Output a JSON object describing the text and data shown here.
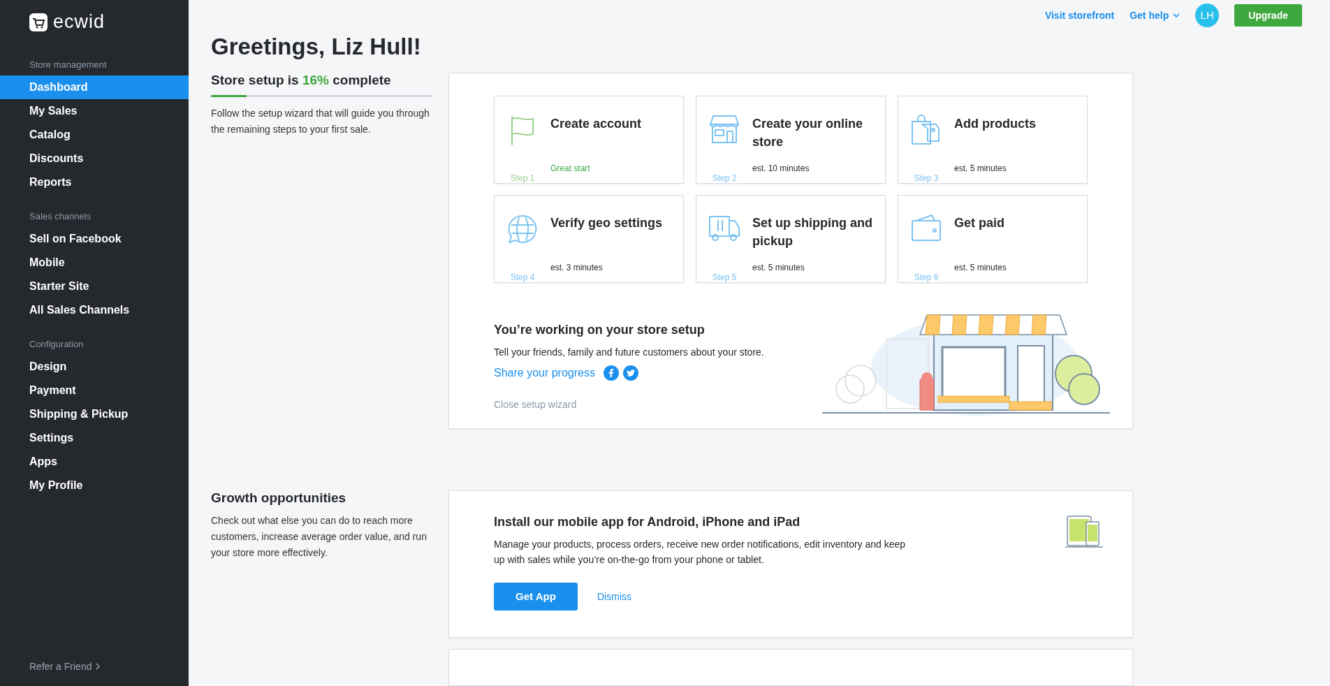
{
  "logo": {
    "text": "ecwid"
  },
  "sidebar": {
    "sections": [
      {
        "heading": "Store management",
        "items": [
          {
            "label": "Dashboard",
            "selected": true
          },
          {
            "label": "My Sales",
            "selected": false
          },
          {
            "label": "Catalog",
            "selected": false
          },
          {
            "label": "Discounts",
            "selected": false
          },
          {
            "label": "Reports",
            "selected": false
          }
        ]
      },
      {
        "heading": "Sales channels",
        "items": [
          {
            "label": "Sell on Facebook",
            "selected": false
          },
          {
            "label": "Mobile",
            "selected": false
          },
          {
            "label": "Starter Site",
            "selected": false
          },
          {
            "label": "All Sales Channels",
            "selected": false
          }
        ]
      },
      {
        "heading": "Configuration",
        "items": [
          {
            "label": "Design",
            "selected": false
          },
          {
            "label": "Payment",
            "selected": false
          },
          {
            "label": "Shipping & Pickup",
            "selected": false
          },
          {
            "label": "Settings",
            "selected": false
          },
          {
            "label": "Apps",
            "selected": false
          },
          {
            "label": "My Profile",
            "selected": false
          }
        ]
      }
    ],
    "footer_link": "Refer a Friend"
  },
  "topbar": {
    "visit_link": "Visit storefront",
    "help_link": "Get help",
    "avatar": "LH",
    "upgrade_button": "Upgrade"
  },
  "greeting": "Greetings, Liz Hull!",
  "setup": {
    "title_before": "Store setup is",
    "percent": "16%",
    "title_after": "complete",
    "level": 0.16,
    "description": "Follow the setup wizard that will guide you through the remaining steps to your first sale.",
    "steps": [
      {
        "kind": "flag",
        "title": "Create account",
        "step": "Step 1",
        "note": "Great start",
        "done": true
      },
      {
        "kind": "store",
        "title": "Create your online store",
        "step": "Step 2",
        "note": "est. 10 minutes",
        "done": false
      },
      {
        "kind": "bag",
        "title": "Add products",
        "step": "Step 3",
        "note": "est. 5 minutes",
        "done": false
      },
      {
        "kind": "globe",
        "title": "Verify geo settings",
        "step": "Step 4",
        "note": "est. 3 minutes",
        "done": false
      },
      {
        "kind": "truck",
        "title": "Set up shipping and pickup",
        "step": "Step 5",
        "note": "est. 5 minutes",
        "done": false
      },
      {
        "kind": "wallet",
        "title": "Get paid",
        "step": "Step 6",
        "note": "est. 5 minutes",
        "done": false
      }
    ],
    "share_title": "You’re working on your store setup",
    "share_text": "Tell your friends, family and future customers about your store.",
    "share_link": "Share your progress",
    "close_link": "Close setup wizard"
  },
  "growth": {
    "title": "Growth opportunities",
    "description": "Check out what else you can do to reach more customers, increase average order value, and run your store more effectively.",
    "card": {
      "title": "Install our mobile app for Android, iPhone and iPad",
      "text": "Manage your products, process orders, receive new order notifications, edit inventory and keep up with sales while you’re on-the-go from your phone or tablet.",
      "primary_button": "Get App",
      "dismiss_link": "Dismiss"
    }
  }
}
